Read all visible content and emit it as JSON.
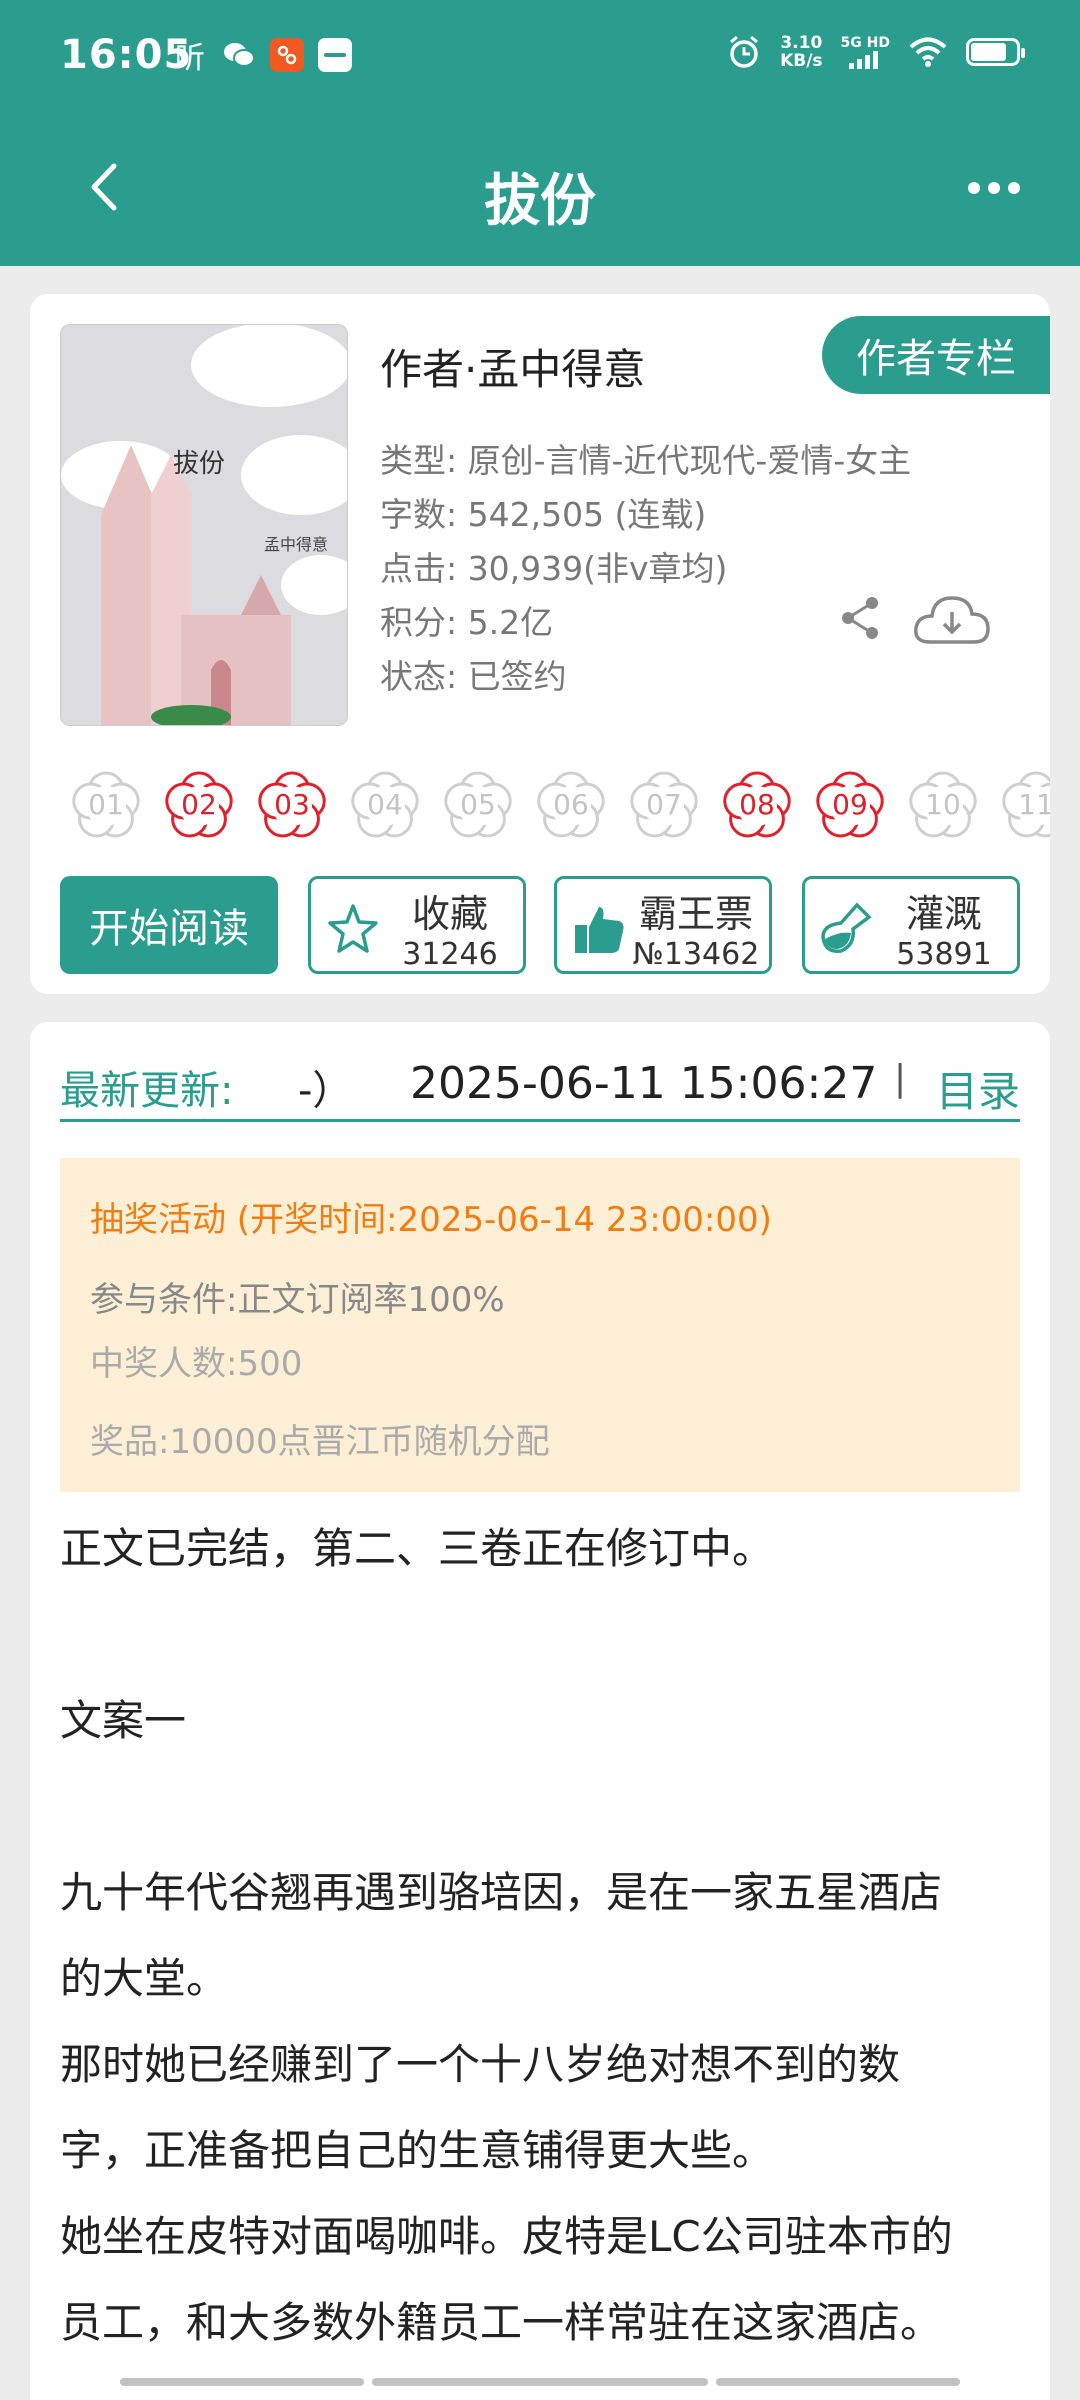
{
  "status_bar": {
    "time": "16:05",
    "app_glyph": "听",
    "speed_value": "3.10",
    "speed_unit": "KB/s",
    "network": "5G HD",
    "battery_percent": 80
  },
  "header": {
    "title": "拔份"
  },
  "book": {
    "cover_title": "拔份",
    "cover_author": "孟中得意",
    "author_label": "作者·孟中得意",
    "author_column_button": "作者专栏",
    "meta": [
      "类型: 原创-言情-近代现代-爱情-女主",
      "字数: 542,505 (连载)",
      "点击: 30,939(非v章均)",
      "积分: 5.2亿",
      "状态: 已签约"
    ],
    "flowers": [
      {
        "label": "01",
        "active": false
      },
      {
        "label": "02",
        "active": true
      },
      {
        "label": "03",
        "active": true
      },
      {
        "label": "04",
        "active": false
      },
      {
        "label": "05",
        "active": false
      },
      {
        "label": "06",
        "active": false
      },
      {
        "label": "07",
        "active": false
      },
      {
        "label": "08",
        "active": true
      },
      {
        "label": "09",
        "active": true
      },
      {
        "label": "10",
        "active": false
      },
      {
        "label": "11",
        "active": false
      }
    ],
    "start_reading": "开始阅读",
    "collect": {
      "label": "收藏",
      "count": "31246"
    },
    "bawangpiao": {
      "label": "霸王票",
      "count": "№13462"
    },
    "irrigate": {
      "label": "灌溉",
      "count": "53891"
    }
  },
  "update": {
    "label": "最新更新:",
    "chapter_fragment": "-）",
    "datetime": "2025-06-11 15:06:27",
    "separator": "|",
    "catalog": "目录"
  },
  "lottery": {
    "title": "抽奖活动 (开奖时间:2025-06-14 23:00:00)",
    "condition": "参与条件:正文订阅率100%",
    "winners": "中奖人数:500",
    "prize": "奖品:10000点晋江币随机分配"
  },
  "description": [
    "正文已完结，第二、三卷正在修订中。",
    "",
    "文案一",
    "",
    "九十年代谷翘再遇到骆培因，是在一家五星酒店",
    "的大堂。",
    "那时她已经赚到了一个十八岁绝对想不到的数",
    "字，正准备把自己的生意铺得更大些。",
    "她坐在皮特对面喝咖啡。皮特是LC公司驻本市的",
    "员工，和大多数外籍员工一样常驻在这家酒店。"
  ],
  "colors": {
    "accent": "#2a9d8f",
    "flower_active": "#e0202c",
    "lottery_bg": "#fdefd6",
    "lottery_title": "#ef7d12"
  }
}
